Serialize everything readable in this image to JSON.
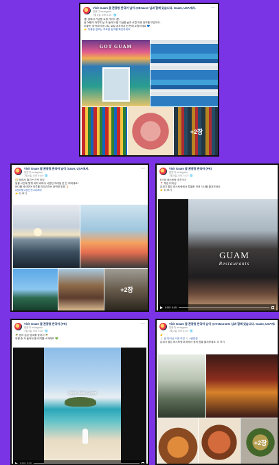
{
  "posts": [
    {
      "page_name": "Visit Guam 괌 관광청 한국어 님이 @Beauxe 님과 함께 있습니다. Guam, USA에서.",
      "sub": "방문자 Instagram",
      "time": "7월 8일 오후 6:15 · 🌐",
      "lines": [
        "🛍 괌에서 기념품 쇼핑 가이드 🛍",
        "괌 여행의 마지막 날 꼭 들러야 할 기념품 숍과 로컬 마켓 정보를 모았어요.",
        "초콜릿, 마카다미아 너트, 로컬 과자까지 한 번에 쇼핑하세요 💙",
        "👉 자세한 정보는 프로필 링크를 확인하세요"
      ],
      "shop_sign": "GOT GUAM",
      "more": "+2장"
    },
    {
      "page_name": "Visit Guam 괌 관광청 한국어 님이 Guam, USA에서.",
      "sub": "방문자 Instagram",
      "time": "7월 6일 오후 5:48 · 🌐",
      "lines": [
        "🌅 괌에서 즐기는 선셋 타임",
        "일몰 시간에 맞춰 비치 바에서 시원한 칵테일 한 잔 어떠세요?",
        "바다를 바라보며 하루를 마무리하는 완벽한 방법 🍹",
        "#괌여행 #괌선셋 #비치바",
        "👉 더 보기"
      ],
      "more": "+2장"
    },
    {
      "page_name": "Visit Guam 괌 관광청 한국어 (PR)",
      "sub": "방문자 Instagram",
      "time": "7월 5일 오후 7:02 · 🌐",
      "lines": [
        "🍽 괌 레스토랑 추천 🍽",
        "📍 투몬 다이닝",
        "분위기 좋은 레스토랑에서 특별한 저녁 식사를 즐겨보세요.",
        "👉 더 보기"
      ],
      "video_title": "GUAM",
      "video_subtitle": "Restaurants",
      "video_time": "0:00 / 0:45"
    },
    {
      "page_name": "Visit Guam 괌 관광청 한국어 (PR)",
      "sub": "방문자 Instagram",
      "time": "7월 4일 오후 4:30 · 🌐",
      "lines": [
        "🌴 괌의 숨은 명소를 찾아서 🌴",
        "여행 중 꼭 들러야 할 비치를 소개해요 💚"
      ],
      "video_title": "Hafa Adai Guam",
      "video_time": "0:00 / 0:30"
    },
    {
      "page_name": "Visit Guam 괌 관광청 한국어 님이 @restaurants 님과 함께 있습니다. Guam, USA에서.",
      "sub": "방문자 Instagram",
      "time": "7월 2일 오후 8:10 · 🌐",
      "lines": [
        "👉",
        "🍴 괌 다이닝 스팟 추천 🍴 #괌맛집",
        "분위기 좋은 레스토랑과 바에서 괌의 밤을 즐겨보세요. 더 보기"
      ],
      "more": "+2장"
    }
  ],
  "colors": {
    "background": "#7b33e6",
    "link": "#2d5fb8"
  }
}
